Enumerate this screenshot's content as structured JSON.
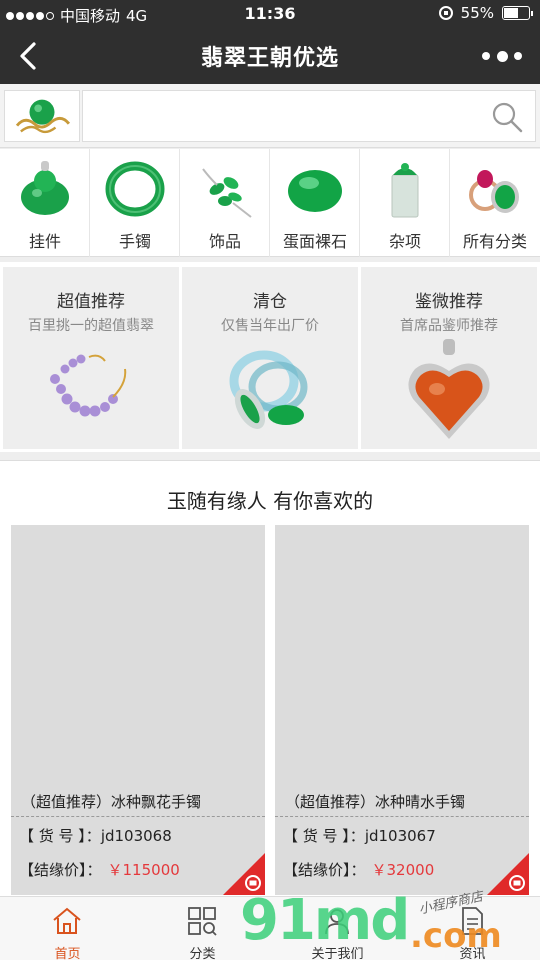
{
  "status_bar": {
    "carrier": "中国移动",
    "network": "4G",
    "time": "11:36",
    "battery": "55%"
  },
  "navbar": {
    "title": "翡翠王朝优选"
  },
  "search": {
    "placeholder": "",
    "value": ""
  },
  "categories": [
    {
      "label": "挂件",
      "icon": "jade-pendant-icon"
    },
    {
      "label": "手镯",
      "icon": "jade-bracelet-icon"
    },
    {
      "label": "饰品",
      "icon": "jade-brooch-icon"
    },
    {
      "label": "蛋面裸石",
      "icon": "jade-cabochon-icon"
    },
    {
      "label": "杂项",
      "icon": "jade-seal-icon"
    },
    {
      "label": "所有分类",
      "icon": "jade-ring-icon"
    }
  ],
  "promos": [
    {
      "title": "超值推荐",
      "subtitle": "百里挑一的超值翡翠"
    },
    {
      "title": "清仓",
      "subtitle": "仅售当年出厂价"
    },
    {
      "title": "鉴微推荐",
      "subtitle": "首席品鉴师推荐"
    }
  ],
  "recommend": {
    "heading": "玉随有缘人 有你喜欢的"
  },
  "products": [
    {
      "name": "（超值推荐）冰种飘花手镯",
      "code_label": "【 货 号 】：",
      "code": "jd103068",
      "price_label": "【结缘价】：",
      "price": "￥115000"
    },
    {
      "name": "（超值推荐）冰种晴水手镯",
      "code_label": "【 货 号 】：",
      "code": "jd103067",
      "price_label": "【结缘价】：",
      "price": "￥32000"
    }
  ],
  "tabbar": [
    {
      "label": "首页",
      "active": true
    },
    {
      "label": "分类",
      "active": false
    },
    {
      "label": "关于我们",
      "active": false
    },
    {
      "label": "资讯",
      "active": false
    }
  ],
  "watermark": {
    "num": "91md",
    "com": ".com",
    "hand": "小程序商店"
  },
  "colors": {
    "nav_bg": "#2f2f2f",
    "price_red": "#e4393c",
    "active_tab": "#d9531e",
    "jade_green": "#1aa14a"
  }
}
